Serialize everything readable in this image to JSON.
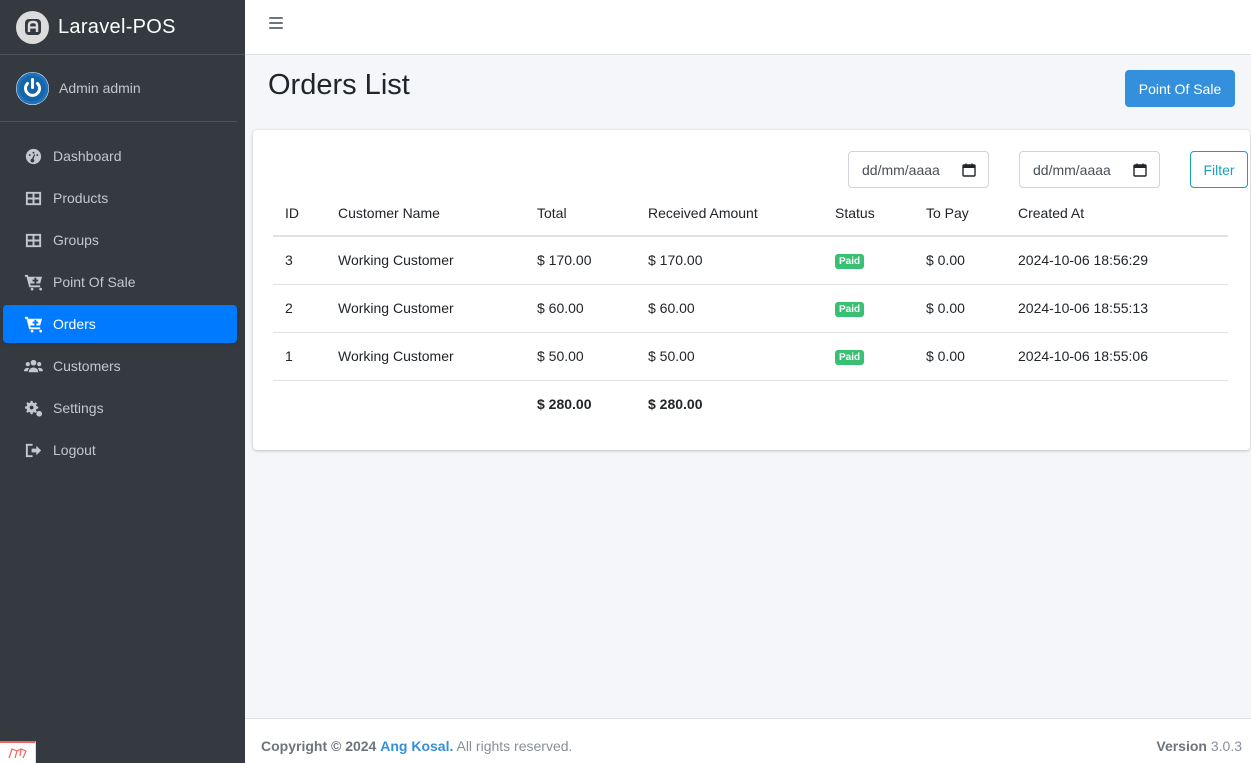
{
  "brand": {
    "name": "Laravel-POS",
    "logo_icon": "laravel-pos-logo"
  },
  "user": {
    "name": "Admin admin",
    "avatar_icon": "power-avatar"
  },
  "sidebar": {
    "items": [
      {
        "label": "Dashboard",
        "icon": "tachometer-icon",
        "active": false
      },
      {
        "label": "Products",
        "icon": "table-icon",
        "active": false
      },
      {
        "label": "Groups",
        "icon": "table-icon",
        "active": false
      },
      {
        "label": "Point Of Sale",
        "icon": "cart-plus-icon",
        "active": false
      },
      {
        "label": "Orders",
        "icon": "cart-plus-icon",
        "active": true
      },
      {
        "label": "Customers",
        "icon": "users-icon",
        "active": false
      },
      {
        "label": "Settings",
        "icon": "cogs-icon",
        "active": false
      },
      {
        "label": "Logout",
        "icon": "sign-out-icon",
        "active": false
      }
    ]
  },
  "page": {
    "title": "Orders List",
    "pos_button": "Point Of Sale"
  },
  "filters": {
    "start_date_placeholder": "dd/mm/aaaa",
    "end_date_placeholder": "dd/mm/aaaa",
    "filter_button": "Filter"
  },
  "table": {
    "headers": [
      "ID",
      "Customer Name",
      "Total",
      "Received Amount",
      "Status",
      "To Pay",
      "Created At"
    ],
    "rows": [
      {
        "id": "3",
        "customer": "Working Customer",
        "total": "$ 170.00",
        "received": "$ 170.00",
        "status": "Paid",
        "to_pay": "$ 0.00",
        "created_at": "2024-10-06 18:56:29"
      },
      {
        "id": "2",
        "customer": "Working Customer",
        "total": "$ 60.00",
        "received": "$ 60.00",
        "status": "Paid",
        "to_pay": "$ 0.00",
        "created_at": "2024-10-06 18:55:13"
      },
      {
        "id": "1",
        "customer": "Working Customer",
        "total": "$ 50.00",
        "received": "$ 50.00",
        "status": "Paid",
        "to_pay": "$ 0.00",
        "created_at": "2024-10-06 18:55:06"
      }
    ],
    "footer": {
      "total": "$ 280.00",
      "received": "$ 280.00"
    }
  },
  "footer": {
    "copyright": "Copyright © 2024",
    "author": "Ang Kosal.",
    "rights": "All rights reserved.",
    "version_label": "Version",
    "version": "3.0.3"
  },
  "colors": {
    "sidebar_bg": "#343a40",
    "active_nav": "#007bff",
    "primary_button": "#3490dc",
    "paid_badge": "#38c172",
    "filter_outline": "#17a2b8"
  }
}
